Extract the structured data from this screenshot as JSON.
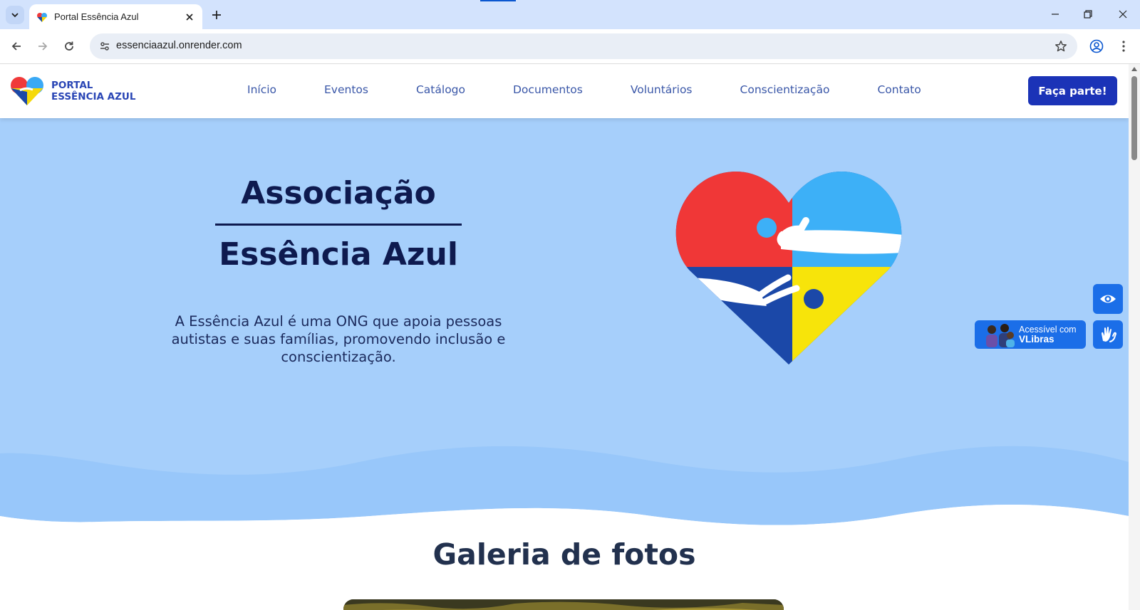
{
  "browser": {
    "tab_title": "Portal Essência Azul",
    "url": "essenciaazul.onrender.com"
  },
  "site": {
    "logo_line1": "PORTAL",
    "logo_line2": "ESSÊNCIA AZUL",
    "nav": [
      "Início",
      "Eventos",
      "Catálogo",
      "Documentos",
      "Voluntários",
      "Conscientização",
      "Contato"
    ],
    "cta_label": "Faça parte!"
  },
  "hero": {
    "title_line1": "Associação",
    "title_line2": "Essência Azul",
    "description": "A Essência Azul é uma ONG que apoia pessoas autistas e suas famílias, promovendo inclusão e conscientização."
  },
  "accessibility": {
    "vlibras_line1": "Acessível com",
    "vlibras_line2": "VLibras"
  },
  "gallery": {
    "title": "Galeria de fotos"
  },
  "colors": {
    "hero_bg": "#a6cffb",
    "primary": "#1b33b7",
    "nav_text": "#3a57a8",
    "accessibility_blue": "#1b6ee8"
  }
}
